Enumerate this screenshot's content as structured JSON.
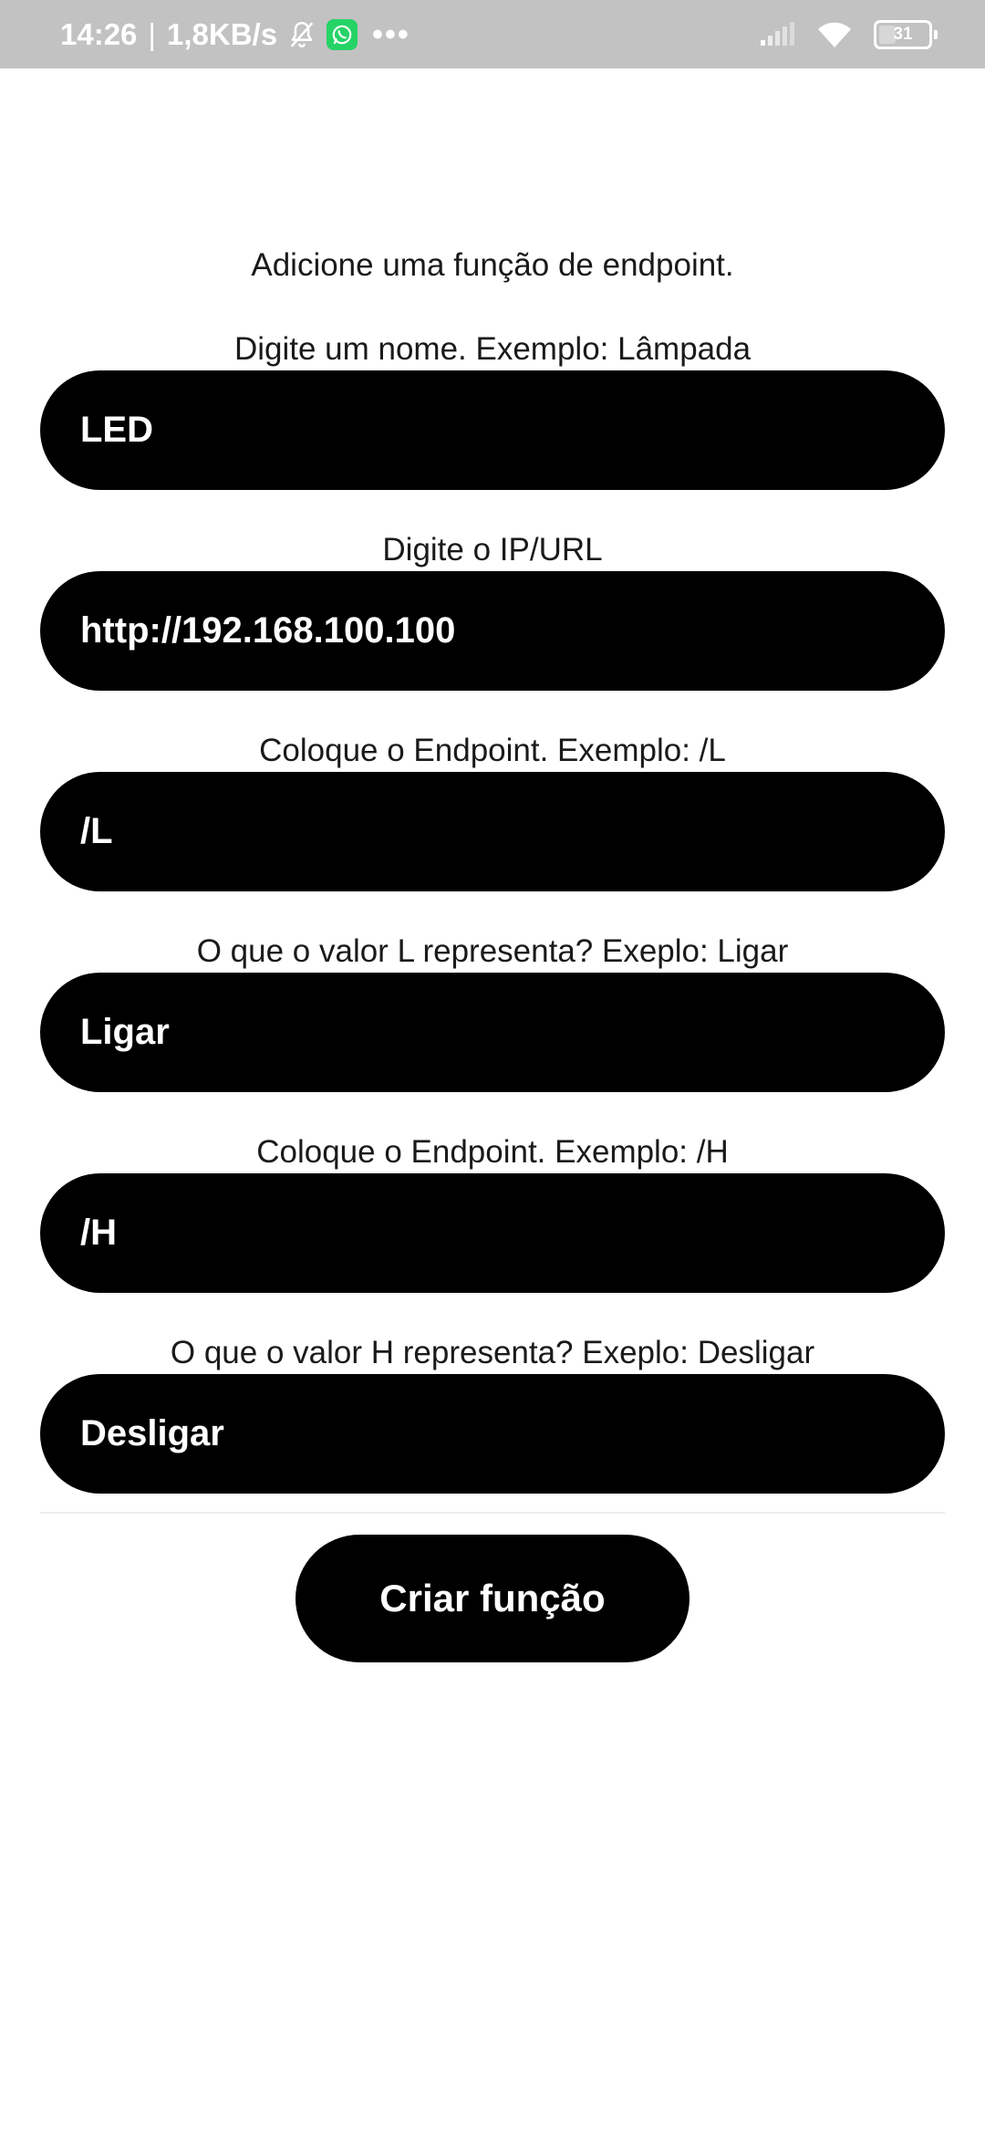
{
  "status_bar": {
    "time": "14:26",
    "separator": "|",
    "network_speed": "1,8KB/s",
    "battery_level": "31",
    "icons": [
      "notifications-muted-icon",
      "whatsapp-icon",
      "more-dots-icon",
      "signal-icon",
      "wifi-icon",
      "battery-icon"
    ],
    "background_color": "#c2c2c2"
  },
  "form": {
    "heading": "Adicione uma função de endpoint.",
    "fields": [
      {
        "label": "Digite um nome. Exemplo: Lâmpada",
        "value": "LED"
      },
      {
        "label": "Digite o IP/URL",
        "value": "http://192.168.100.100"
      },
      {
        "label": "Coloque o Endpoint. Exemplo: /L",
        "value": "/L"
      },
      {
        "label": "O que o valor L representa? Exeplo: Ligar",
        "value": "Ligar"
      },
      {
        "label": "Coloque o Endpoint. Exemplo: /H",
        "value": "/H"
      },
      {
        "label": "O que o valor H representa? Exeplo: Desligar",
        "value": "Desligar"
      }
    ],
    "submit_label": "Criar função",
    "input_background_color": "#000000",
    "input_text_color": "#ffffff"
  }
}
